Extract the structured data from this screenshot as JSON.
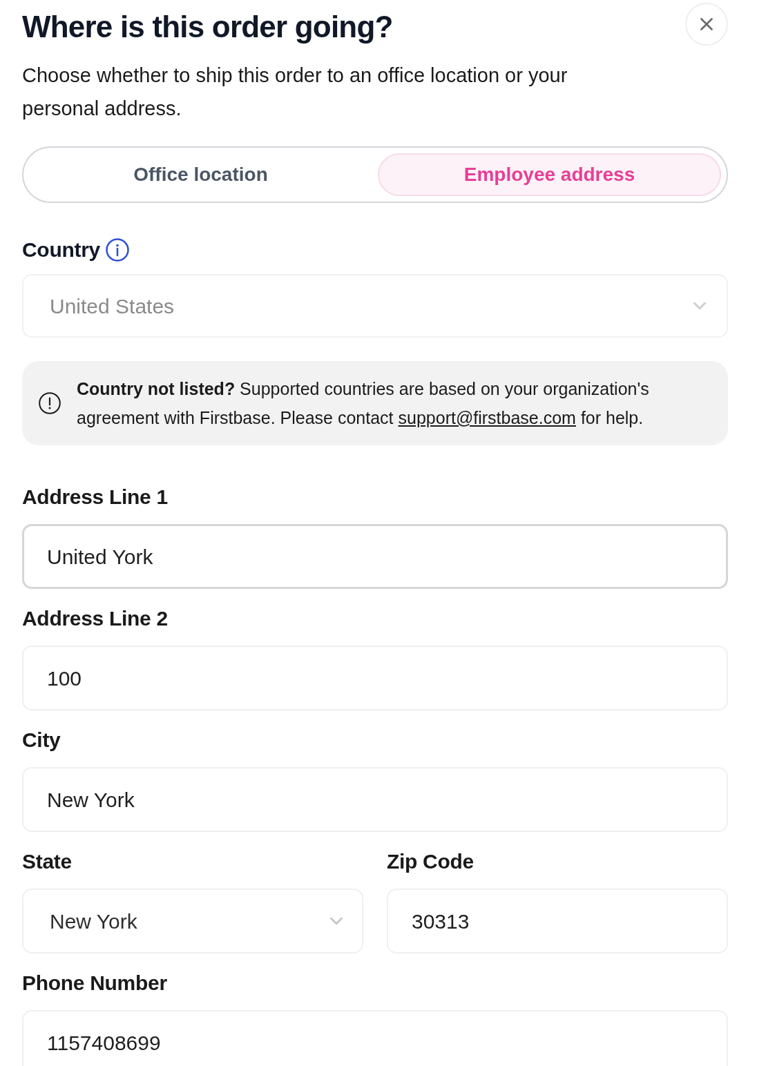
{
  "dialog": {
    "title": "Where is this order going?",
    "description": "Choose whether to ship this order to an office location or your personal address."
  },
  "destination_tabs": [
    {
      "label": "Office location",
      "selected": false
    },
    {
      "label": "Employee address",
      "selected": true
    }
  ],
  "country": {
    "label": "Country",
    "value": "United States",
    "disabled": true
  },
  "notice": {
    "text": "**Country not listed?** Supported countries are based on your organization's agreement with Firstbase. Please contact",
    "link": "support@firstbase.com",
    "suffix": "for help."
  },
  "address_rows": [
    {
      "fields": [
        {
          "label": "Address Line 1",
          "value": "United York",
          "kind": "text",
          "focused": true
        }
      ]
    },
    {
      "fields": [
        {
          "label": "Address Line 2",
          "value": "100",
          "kind": "text",
          "focused": false
        }
      ]
    },
    {
      "fields": [
        {
          "label": "City",
          "value": "New York",
          "kind": "text",
          "focused": false
        }
      ]
    },
    {
      "fields": [
        {
          "label": "State",
          "value": "New York",
          "kind": "select",
          "focused": false
        },
        {
          "label": "Zip Code",
          "value": "30313",
          "kind": "text",
          "focused": false
        }
      ]
    },
    {
      "fields": [
        {
          "label": "Phone Number",
          "value": "1157408699",
          "kind": "text",
          "focused": false
        }
      ]
    }
  ]
}
